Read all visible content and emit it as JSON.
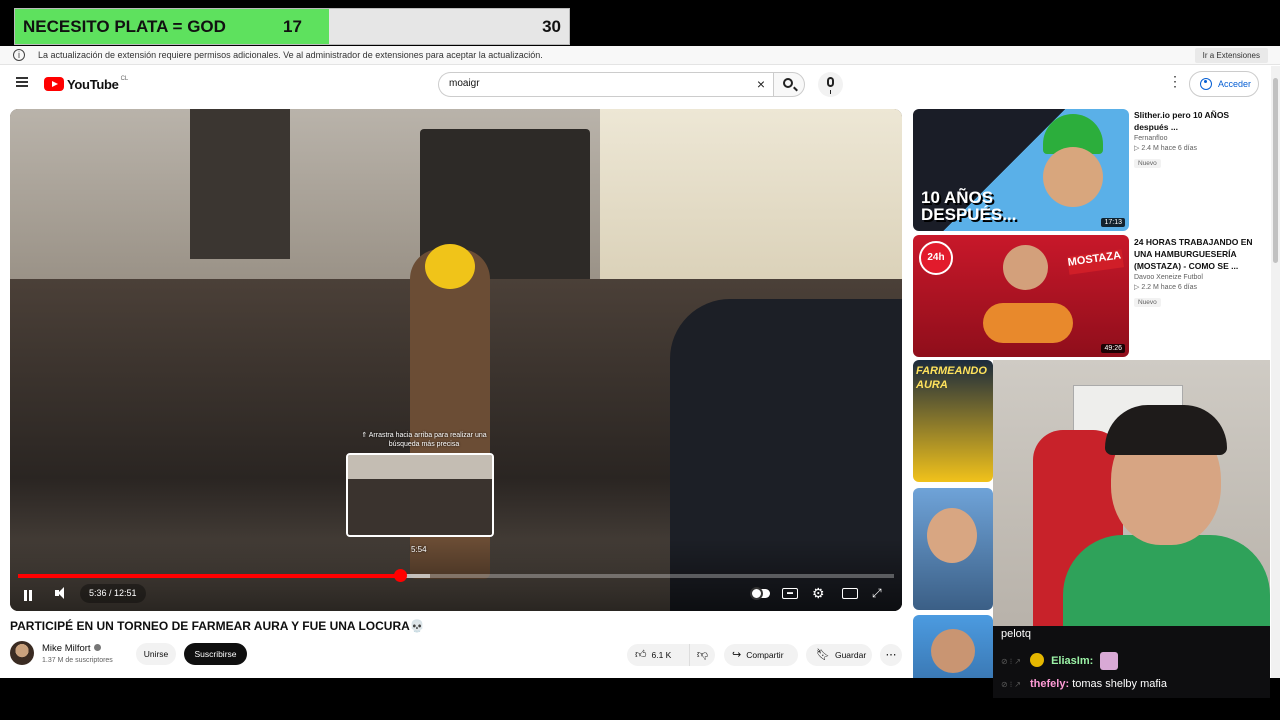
{
  "goal": {
    "title": "NECESITO PLATA = GOD",
    "current": "17",
    "max": "30",
    "fill_fraction": 0.567,
    "fill_color": "#5ee15e"
  },
  "infobar": {
    "icon": "info-icon",
    "message": "La actualización de extensión requiere permisos adicionales. Ve al administrador de extensiones para aceptar la actualización.",
    "button": "Ir a Extensiones"
  },
  "masthead": {
    "logo_text": "YouTube",
    "logo_region": "CL",
    "search_value": "moaigr",
    "clear_icon": "×",
    "more_icon": "⋮",
    "login_label": "Acceder",
    "accent": "#065fd4",
    "brand_red": "#ff0000"
  },
  "player": {
    "scrub_hint": "⇑ Arrastra hacia arriba para realizar una búsqueda más precisa",
    "scrub_time": "5:54",
    "time_display": "5:36 / 12:51",
    "played_fraction": 0.436,
    "buffered_fraction": 0.47
  },
  "video": {
    "title": "PARTICIPÉ EN UN TORNEO DE FARMEAR AURA Y FUE UNA LOCURA💀",
    "channel": "Mike Milfort",
    "subscribers": "1.37 M de suscriptores",
    "join_label": "Unirse",
    "subscribe_label": "Suscribirse",
    "likes": "6.1 K",
    "share_label": "Compartir",
    "save_label": "Guardar",
    "more_icon": "⋯"
  },
  "sidebar": {
    "items": [
      {
        "title": "Slither.io pero 10 AÑOS después ...",
        "channel": "Fernanfloo",
        "meta": "▷ 2.4 M   hace 6 días",
        "badge": "Nuevo",
        "duration": "17:13",
        "thumb_text": "10 AÑOS DESPUÉS..."
      },
      {
        "title": "24 HORAS TRABAJANDO EN UNA HAMBURGUESERÍA (MOSTAZA) - COMO SE ...",
        "channel": "Davoo Xeneize Futbol",
        "meta": "▷ 2.2 M   hace 6 días",
        "badge": "Nuevo",
        "duration": "49:26",
        "thumb_text": "MOSTAZA"
      },
      {
        "thumb_text": "FARMEANDO AURA"
      },
      {
        "thumb_text": ""
      },
      {
        "thumb_text": ""
      }
    ]
  },
  "chat": {
    "lines": [
      {
        "user": "",
        "text": "pelotq"
      },
      {
        "user": "EliasIm:",
        "text": "",
        "user_color": "#9bf2a6"
      },
      {
        "user": "thefely:",
        "text": " tomas shelby mafia",
        "user_color": "#ff9bd6"
      }
    ]
  }
}
